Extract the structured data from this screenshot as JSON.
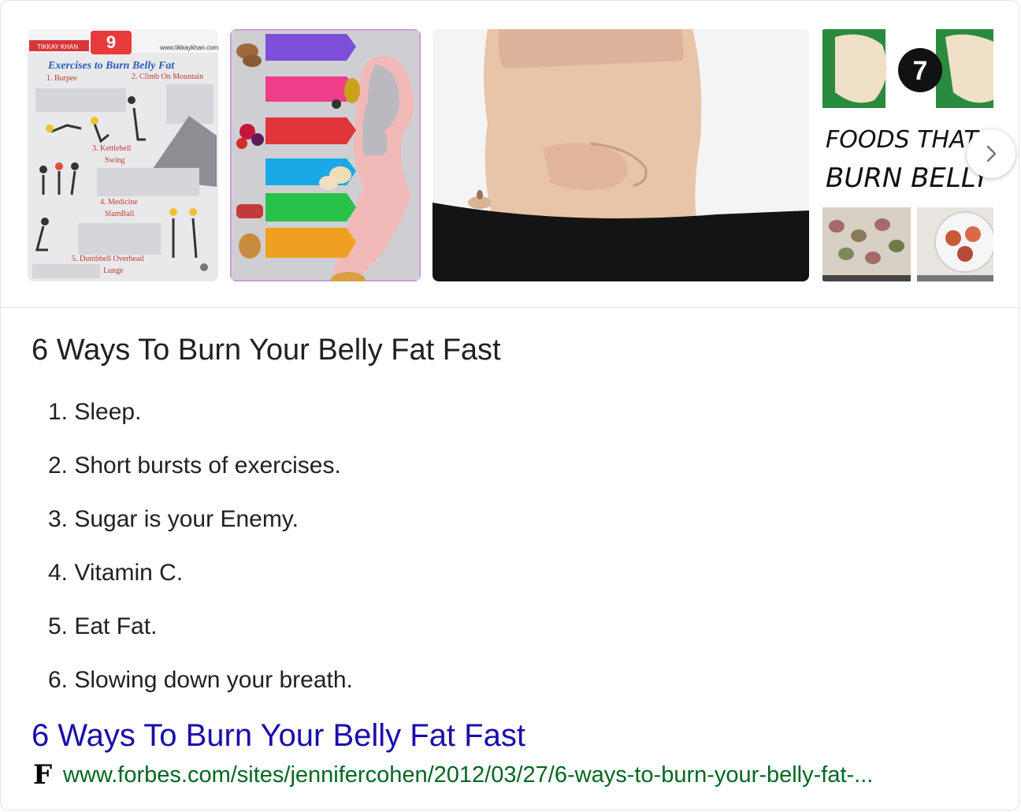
{
  "carousel": {
    "thumbs": [
      {
        "icon": "exercises-infographic",
        "brand": "TIKKAY KHAN",
        "badge": "9",
        "site": "www.tikkaykhan.com",
        "title": "Exercises to Burn Belly Fat",
        "labels": [
          "1. Burpee",
          "2. Climb On Mountain",
          "3. Kettlebell",
          "Swing",
          "4. Medicine",
          "SlamBall",
          "5. Dumbbell Overhead",
          "Lunge"
        ]
      },
      {
        "icon": "foods-infographic"
      },
      {
        "icon": "belly-photo"
      },
      {
        "icon": "foods-list-image",
        "badge": "7",
        "line1": "FOODS THAT QUIC",
        "line2": "BURN BELLY FA"
      }
    ],
    "next_icon": "chevron-right-icon"
  },
  "snippet": {
    "heading": "6 Ways To Burn Your Belly Fat Fast",
    "steps": [
      "1. Sleep.",
      "2. Short bursts of exercises.",
      "3. Sugar is your Enemy.",
      "4. Vitamin C.",
      "5. Eat Fat.",
      "6. Slowing down your breath."
    ]
  },
  "result": {
    "title": "6 Ways To Burn Your Belly Fat Fast",
    "favicon": "F",
    "url": "www.forbes.com/sites/jennifercohen/2012/03/27/6-ways-to-burn-your-belly-fat-..."
  },
  "colors": {
    "link": "#1a0dab",
    "url": "#006621",
    "text": "#202124"
  }
}
